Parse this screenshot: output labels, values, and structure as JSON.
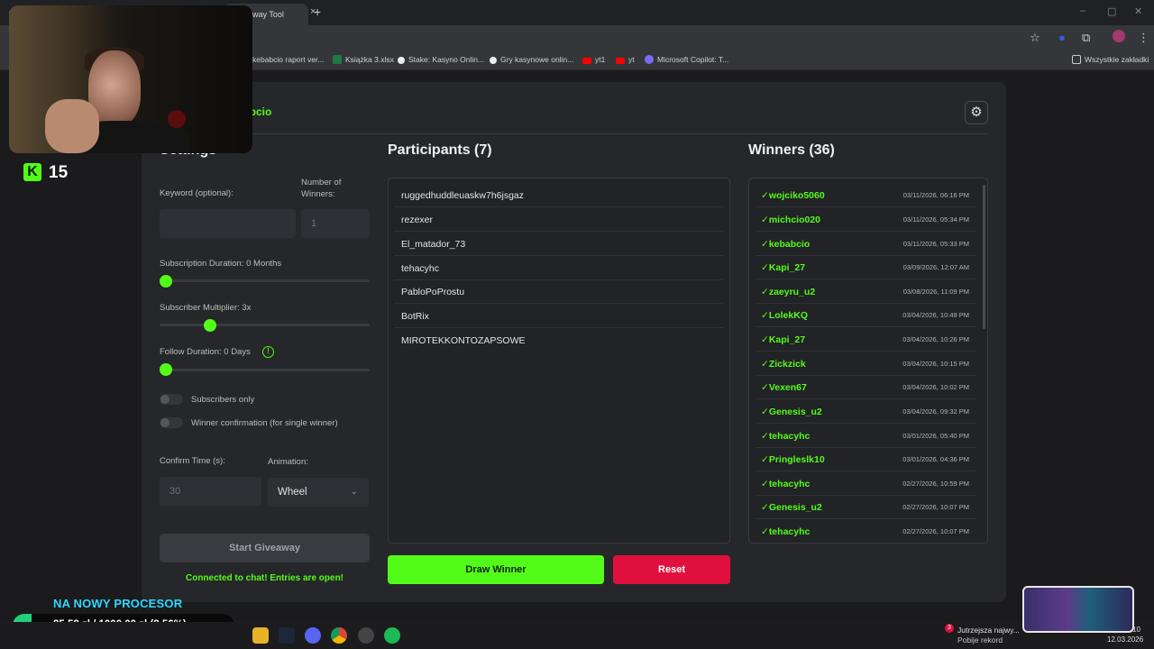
{
  "browser": {
    "tab_title": "eaway Tool",
    "tab_close": "×",
    "new_tab": "+",
    "bookmarks": [
      {
        "label": "kebabcio raport ver...",
        "icon": "doc-icon",
        "color": "#2b5dab"
      },
      {
        "label": "Książka 3.xlsx",
        "icon": "excel-icon",
        "color": "#1d7a45"
      },
      {
        "label": "Stake: Kasyno Onlin...",
        "icon": "stake-icon",
        "color": "#ffffff"
      },
      {
        "label": "Gry kasynowe onlin...",
        "icon": "stake-icon",
        "color": "#ffffff"
      },
      {
        "label": "yt1",
        "icon": "youtube-icon",
        "color": "#ff0000"
      },
      {
        "label": "yt",
        "icon": "youtube-icon",
        "color": "#ff0000"
      },
      {
        "label": "Microsoft Copilot: T...",
        "icon": "copilot-icon",
        "color": "#7f6bf0"
      }
    ],
    "all_bookmarks": "Wszystkie zakładki"
  },
  "overlay": {
    "kick_logo": "K",
    "kick_count": "15",
    "goal_title": "NA NOWY PROCESOR",
    "goal_progress": "85,58 zł / 1000,00 zł (8.56%)",
    "goal_fraction": 0.0856
  },
  "app": {
    "channel_name": "abcio",
    "settings_title": "Settings",
    "keyword_label": "Keyword (optional):",
    "keyword_value": "",
    "num_winners_label": "Number of Winners:",
    "num_winners_placeholder": "1",
    "sub_duration_label": "Subscription Duration: 0 Months",
    "sub_duration_value": 0,
    "sub_multiplier_label": "Subscriber Multiplier: 3x",
    "sub_multiplier_value": 3,
    "follow_duration_label": "Follow Duration:  0  Days",
    "follow_duration_value": 0,
    "subs_only_label": "Subscribers only",
    "winner_confirm_label": "Winner confirmation (for single winner)",
    "confirm_time_label": "Confirm Time (s):",
    "confirm_time_placeholder": "30",
    "animation_label": "Animation:",
    "animation_value": "Wheel",
    "start_button": "Start Giveaway",
    "connected_status": "Connected to chat! Entries are open!",
    "participants_title": "Participants (7)",
    "participants": [
      "ruggedhuddleuaskw7h6jsgaz",
      "rezexer",
      "El_matador_73",
      "tehacyhc",
      "PabloPoProstu",
      "BotRix",
      "MIROTEKKONTOZAPSOWE"
    ],
    "winners_title": "Winners (36)",
    "winners": [
      {
        "name": "wojciko5060",
        "date": "03/11/2026, 06:16 PM"
      },
      {
        "name": "michcio020",
        "date": "03/11/2026, 05:34 PM"
      },
      {
        "name": "kebabcio",
        "date": "03/11/2026, 05:33 PM"
      },
      {
        "name": "Kapi_27",
        "date": "03/09/2026, 12:07 AM"
      },
      {
        "name": "zaeyru_u2",
        "date": "03/08/2026, 11:09 PM"
      },
      {
        "name": "LolekKQ",
        "date": "03/04/2026, 10:49 PM"
      },
      {
        "name": "Kapi_27",
        "date": "03/04/2026, 10:26 PM"
      },
      {
        "name": "Zickzick",
        "date": "03/04/2026, 10:15 PM"
      },
      {
        "name": "Vexen67",
        "date": "03/04/2026, 10:02 PM"
      },
      {
        "name": "Genesis_u2",
        "date": "03/04/2026, 09:32 PM"
      },
      {
        "name": "tehacyhc",
        "date": "03/01/2026, 05:40 PM"
      },
      {
        "name": "Pringleslk10",
        "date": "03/01/2026, 04:36 PM"
      },
      {
        "name": "tehacyhc",
        "date": "02/27/2026, 10:59 PM"
      },
      {
        "name": "Genesis_u2",
        "date": "02/27/2026, 10:07 PM"
      },
      {
        "name": "tehacyhc",
        "date": "02/27/2026, 10:07 PM"
      }
    ],
    "check_mark": "✓",
    "draw_button": "Draw Winner",
    "reset_button": "Reset",
    "accent_color": "#53fc18",
    "reset_color": "#e0103e"
  },
  "taskbar": {
    "notification_count": "3",
    "notification_title": "Jutrzejsza najwy...",
    "notification_subtitle": "Pobije rekord",
    "clock_time": "10",
    "clock_date": "12.03.2026"
  }
}
